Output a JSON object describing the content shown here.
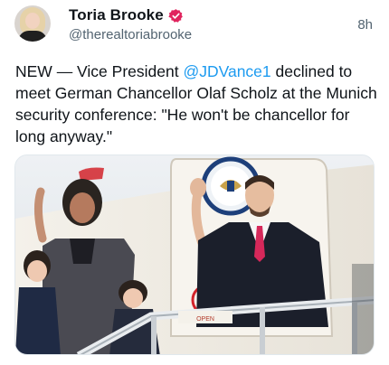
{
  "post": {
    "author": {
      "display_name": "Toria Brooke",
      "handle": "@therealtoriabrooke",
      "verified": true,
      "avatar_icon": "profile-photo"
    },
    "timestamp": "8h",
    "text": {
      "prefix": "NEW — Vice President ",
      "mention": "@JDVance1",
      "suffix": " declined to meet German Chancellor Olaf Scholz at the Munich security conference: \"He won't be chancellor for long anyway.\""
    },
    "media": {
      "stair_sign": "OPEN"
    }
  },
  "colors": {
    "mention": "#1d9bf0",
    "secondary_text": "#536471",
    "verified_badge": "#e0245e"
  }
}
